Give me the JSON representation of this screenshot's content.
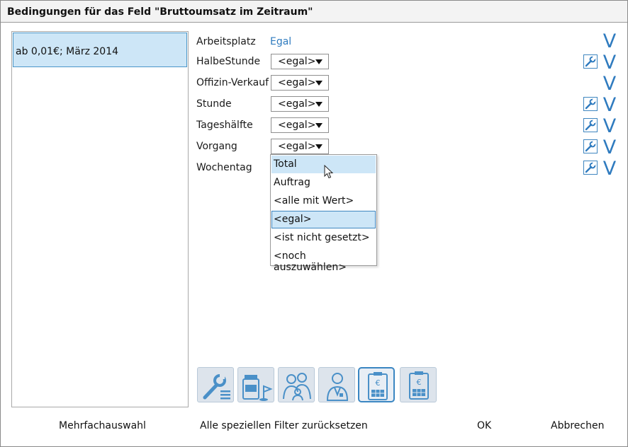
{
  "window": {
    "title": "Bedingungen für das Feld \"Bruttoumsatz im Zeitraum\""
  },
  "list": {
    "items": [
      "ab 0,01€; März 2014"
    ]
  },
  "conditions": [
    {
      "label": "Arbeitsplatz",
      "value": "Egal",
      "has_wrench": false
    },
    {
      "label": "HalbeStunde",
      "value": "<egal>",
      "has_wrench": true
    },
    {
      "label": "Offizin-Verkauf",
      "value": "<egal>",
      "has_wrench": false
    },
    {
      "label": "Stunde",
      "value": "<egal>",
      "has_wrench": true
    },
    {
      "label": "Tageshälfte",
      "value": "<egal>",
      "has_wrench": true
    },
    {
      "label": "Vorgang",
      "value": "<egal>",
      "has_wrench": true
    },
    {
      "label": "Wochentag",
      "value": "",
      "has_wrench": true
    }
  ],
  "expand_glyph": "V",
  "dropdown": {
    "options": [
      "Total",
      "Auftrag",
      "<alle mit Wert>",
      "<egal>",
      "<ist nicht gesetzt>",
      "<noch auszuwählen>"
    ],
    "hovered": "Total",
    "selected": "<egal>"
  },
  "toolbar": {
    "icons": [
      "wrench-list-icon",
      "pharmacy-product-icon",
      "family-customers-icon",
      "pharmacist-staff-icon",
      "euro-register-icon",
      "euro-register-icon"
    ],
    "active_index": 4
  },
  "footer": {
    "multi_select": "Mehrfachauswahl",
    "reset_filters": "Alle speziellen Filter zurücksetzen",
    "ok": "OK",
    "cancel": "Abbrechen"
  },
  "colors": {
    "accent": "#2f7bbf",
    "selection": "#cde6f7",
    "selection_border": "#3f86c0"
  }
}
